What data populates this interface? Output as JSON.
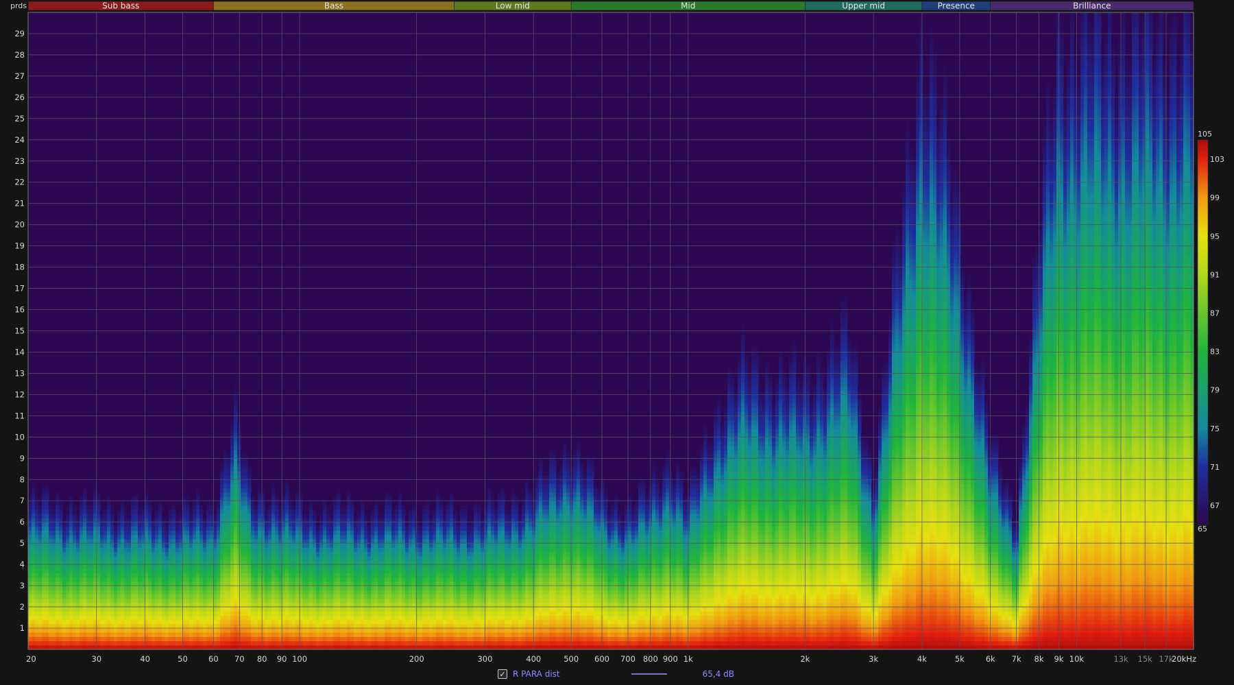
{
  "chart_data": {
    "type": "heatmap",
    "y_unit_label": "prds",
    "x_axis": {
      "scale": "log",
      "range_hz": [
        20,
        20000
      ],
      "ticks": [
        {
          "hz": 20,
          "label": "20"
        },
        {
          "hz": 30,
          "label": "30"
        },
        {
          "hz": 40,
          "label": "40"
        },
        {
          "hz": 50,
          "label": "50"
        },
        {
          "hz": 60,
          "label": "60"
        },
        {
          "hz": 70,
          "label": "70"
        },
        {
          "hz": 80,
          "label": "80"
        },
        {
          "hz": 90,
          "label": "90"
        },
        {
          "hz": 100,
          "label": "100"
        },
        {
          "hz": 200,
          "label": "200"
        },
        {
          "hz": 300,
          "label": "300"
        },
        {
          "hz": 400,
          "label": "400"
        },
        {
          "hz": 500,
          "label": "500"
        },
        {
          "hz": 600,
          "label": "600"
        },
        {
          "hz": 700,
          "label": "700"
        },
        {
          "hz": 800,
          "label": "800"
        },
        {
          "hz": 900,
          "label": "900"
        },
        {
          "hz": 1000,
          "label": "1k"
        },
        {
          "hz": 2000,
          "label": "2k"
        },
        {
          "hz": 3000,
          "label": "3k"
        },
        {
          "hz": 4000,
          "label": "4k"
        },
        {
          "hz": 5000,
          "label": "5k"
        },
        {
          "hz": 6000,
          "label": "6k"
        },
        {
          "hz": 7000,
          "label": "7k"
        },
        {
          "hz": 8000,
          "label": "8k"
        },
        {
          "hz": 9000,
          "label": "9k"
        },
        {
          "hz": 10000,
          "label": "10k"
        },
        {
          "hz": 13000,
          "label": "13k"
        },
        {
          "hz": 15000,
          "label": "15k"
        },
        {
          "hz": 17000,
          "label": "17k"
        },
        {
          "hz": 20000,
          "label": "20kHz"
        }
      ],
      "dim_tick_labels": [
        "13k",
        "15k",
        "17k"
      ]
    },
    "y_axis": {
      "range": [
        0,
        30
      ],
      "ticks": [
        1,
        2,
        3,
        4,
        5,
        6,
        7,
        8,
        9,
        10,
        11,
        12,
        13,
        14,
        15,
        16,
        17,
        18,
        19,
        20,
        21,
        22,
        23,
        24,
        25,
        26,
        27,
        28,
        29
      ]
    },
    "bands": [
      {
        "name": "Sub bass",
        "from_hz": 20,
        "to_hz": 60,
        "color": "#8b1a1a"
      },
      {
        "name": "Bass",
        "from_hz": 60,
        "to_hz": 250,
        "color": "#8a6f1f"
      },
      {
        "name": "Low mid",
        "from_hz": 250,
        "to_hz": 500,
        "color": "#5b7a1f"
      },
      {
        "name": "Mid",
        "from_hz": 500,
        "to_hz": 2000,
        "color": "#2b7a2b"
      },
      {
        "name": "Upper mid",
        "from_hz": 2000,
        "to_hz": 4000,
        "color": "#1f6b5e"
      },
      {
        "name": "Presence",
        "from_hz": 4000,
        "to_hz": 6000,
        "color": "#1e3f7a"
      },
      {
        "name": "Brilliance",
        "from_hz": 6000,
        "to_hz": 20000,
        "color": "#4a2a6e"
      }
    ],
    "color_scale": {
      "min": 65,
      "max": 105,
      "tick_labels": [
        105,
        103,
        99,
        95,
        91,
        87,
        83,
        79,
        75,
        71,
        67,
        65
      ],
      "stops": [
        {
          "value": 65,
          "color": "#2c0752"
        },
        {
          "value": 71,
          "color": "#1f2e9e"
        },
        {
          "value": 75,
          "color": "#138a9e"
        },
        {
          "value": 83,
          "color": "#20b53c"
        },
        {
          "value": 91,
          "color": "#b2d61c"
        },
        {
          "value": 95,
          "color": "#e6e010"
        },
        {
          "value": 99,
          "color": "#f09a12"
        },
        {
          "value": 103,
          "color": "#e2200e"
        },
        {
          "value": 105,
          "color": "#a60d0d"
        }
      ]
    },
    "decay_profile": {
      "description_of_values": "per-frequency extent of energy above floor in prds; level decays from ~105 at 0 to ~65 at extent",
      "points": [
        {
          "hz": 20,
          "extent": 7.2
        },
        {
          "hz": 30,
          "extent": 7.0
        },
        {
          "hz": 40,
          "extent": 6.8
        },
        {
          "hz": 50,
          "extent": 6.8
        },
        {
          "hz": 60,
          "extent": 6.9
        },
        {
          "hz": 68,
          "extent": 11.5
        },
        {
          "hz": 75,
          "extent": 7.5
        },
        {
          "hz": 85,
          "extent": 7.6
        },
        {
          "hz": 100,
          "extent": 6.9
        },
        {
          "hz": 200,
          "extent": 6.8
        },
        {
          "hz": 300,
          "extent": 6.8
        },
        {
          "hz": 400,
          "extent": 7.8
        },
        {
          "hz": 500,
          "extent": 10.0
        },
        {
          "hz": 600,
          "extent": 7.5
        },
        {
          "hz": 700,
          "extent": 6.9
        },
        {
          "hz": 800,
          "extent": 7.8
        },
        {
          "hz": 900,
          "extent": 9.5
        },
        {
          "hz": 1000,
          "extent": 7.3
        },
        {
          "hz": 1200,
          "extent": 12.0
        },
        {
          "hz": 1400,
          "extent": 13.8
        },
        {
          "hz": 2000,
          "extent": 13.0
        },
        {
          "hz": 2600,
          "extent": 15.5
        },
        {
          "hz": 3000,
          "extent": 8.3
        },
        {
          "hz": 4000,
          "extent": 30.0
        },
        {
          "hz": 5000,
          "extent": 21.0
        },
        {
          "hz": 6000,
          "extent": 10.0
        },
        {
          "hz": 7000,
          "extent": 6.5
        },
        {
          "hz": 8000,
          "extent": 20.0
        },
        {
          "hz": 9000,
          "extent": 30.0
        },
        {
          "hz": 10000,
          "extent": 30.0
        },
        {
          "hz": 13000,
          "extent": 30.0
        },
        {
          "hz": 15000,
          "extent": 30.0
        },
        {
          "hz": 17000,
          "extent": 30.0
        },
        {
          "hz": 20000,
          "extent": 30.0
        }
      ]
    }
  },
  "legend": {
    "check_mark": "✓",
    "trace_label": "R PARA dist",
    "trace_color": "#7b72d8",
    "value": "65,4 dB"
  },
  "colors": {
    "background": "#141414",
    "plot_background": "#2c0752",
    "grid": "#555566",
    "text": "#d0d0d0"
  }
}
